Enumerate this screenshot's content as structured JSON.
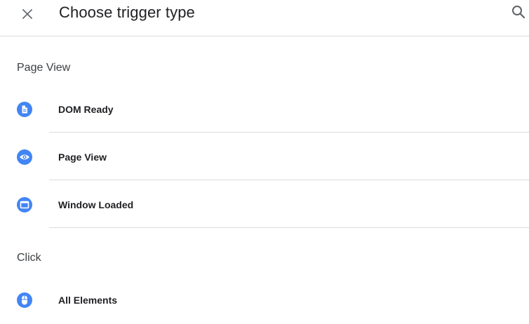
{
  "header": {
    "title": "Choose trigger type",
    "close_icon": "close-icon",
    "search_icon": "search-icon"
  },
  "sections": [
    {
      "heading": "Page View",
      "items": [
        {
          "label": "DOM Ready",
          "icon": "document-icon"
        },
        {
          "label": "Page View",
          "icon": "eye-icon"
        },
        {
          "label": "Window Loaded",
          "icon": "window-icon"
        }
      ]
    },
    {
      "heading": "Click",
      "items": [
        {
          "label": "All Elements",
          "icon": "mouse-icon"
        }
      ]
    }
  ],
  "colors": {
    "accent": "#4285f4",
    "divider": "#dadce0",
    "text": "#202124"
  }
}
